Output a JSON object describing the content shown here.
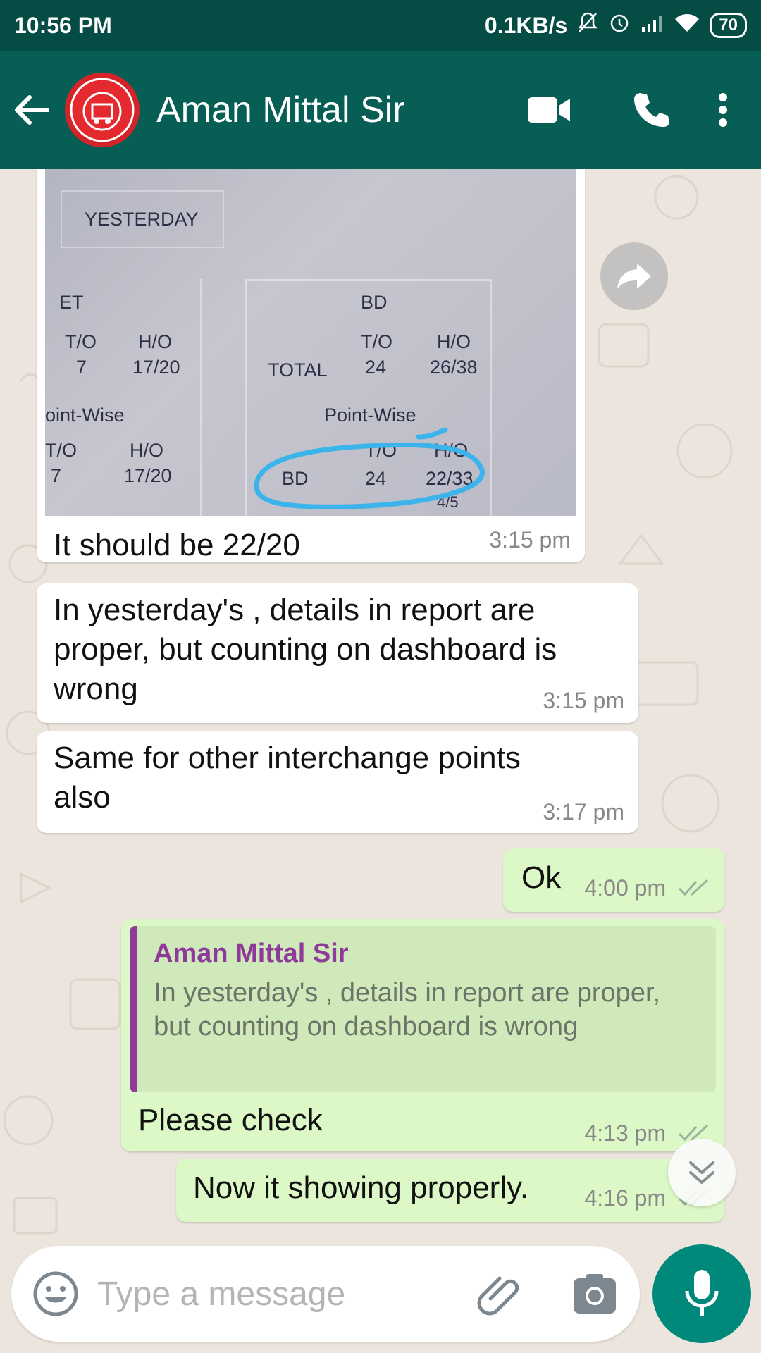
{
  "status_bar": {
    "time": "10:56 PM",
    "net_speed": "0.1KB/s",
    "battery": "70"
  },
  "header": {
    "contact_name": "Aman Mittal Sir",
    "icons": [
      "back-arrow-icon",
      "video-call-icon",
      "phone-icon",
      "more-vert-icon"
    ]
  },
  "photo": {
    "labels": {
      "yesterday": "YESTERDAY",
      "et": "ET",
      "bd": "BD",
      "to": "T/O",
      "ho": "H/O",
      "total": "TOTAL",
      "et_to": "7",
      "et_ho": "17/20",
      "bd_to": "24",
      "bd_ho": "26/38",
      "point_wise_left": "oint-Wise",
      "point_wise": "Point-Wise",
      "pw_left_to_head": "T/O",
      "pw_left_ho_head": "H/O",
      "pw_left_to": "7",
      "pw_left_ho": "17/20",
      "pw_bd": "BD",
      "pw_bd_to_head": "T/O",
      "pw_bd_ho_head": "H/O",
      "pw_bd_to": "24",
      "pw_bd_ho": "22/33",
      "pw_next": "4/5"
    }
  },
  "messages": [
    {
      "text": "It should be 22/20",
      "time": "3:15 pm"
    },
    {
      "text": "In yesterday's , details in report are proper, but counting on dashboard is wrong",
      "time": "3:15 pm"
    },
    {
      "text": "Same for other interchange points also",
      "time": "3:17 pm"
    },
    {
      "text": "Ok",
      "time": "4:00 pm"
    },
    {
      "quote_author": "Aman Mittal Sir",
      "quote_text": "In yesterday's , details in report are proper, but counting on dashboard is wrong",
      "text": "Please check",
      "time": "4:13 pm"
    },
    {
      "text": "Now it showing properly.",
      "time": "4:16 pm"
    }
  ],
  "composer": {
    "placeholder": "Type a message"
  },
  "colors": {
    "header": "#075e54",
    "status_bar": "#054d44",
    "outgoing_bubble": "#dcf8c6",
    "incoming_bubble": "#ffffff",
    "mic_button": "#00897b",
    "quote_accent": "#8e3a9b"
  }
}
